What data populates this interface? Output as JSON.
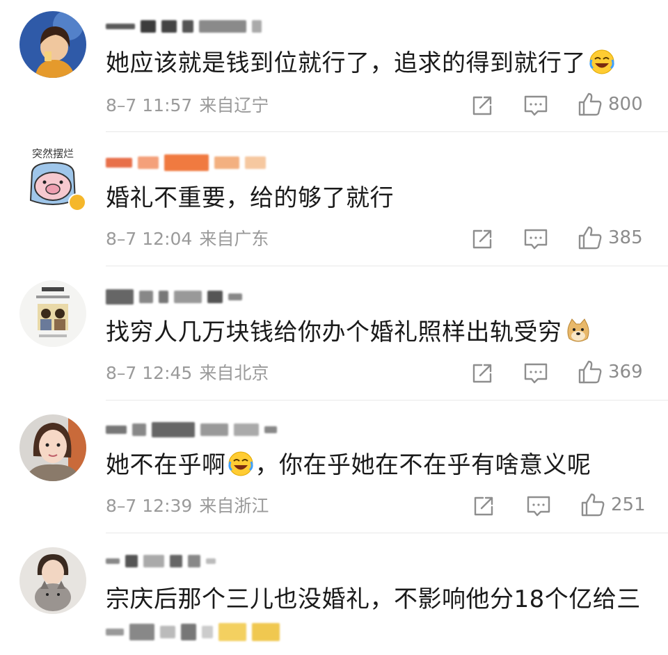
{
  "comments": [
    {
      "text": "她应该就是钱到位就行了，追求的得到就行了",
      "emoji": "laugh-cry-emoji",
      "time": "8–7 11:57",
      "location": "来自辽宁",
      "likes": "800"
    },
    {
      "text": "婚礼不重要，给的够了就行",
      "time": "8–7 12:04",
      "location": "来自广东",
      "likes": "385"
    },
    {
      "text": "找穷人几万块钱给你办个婚礼照样出轨受穷",
      "emoji": "doge-emoji",
      "time": "8–7 12:45",
      "location": "来自北京",
      "likes": "369"
    },
    {
      "text_before": "她不在乎啊",
      "text_after": "，你在乎她在不在乎有啥意义呢",
      "emoji": "laugh-cry-emoji",
      "time": "8–7 12:39",
      "location": "来自浙江",
      "likes": "251"
    },
    {
      "text": "宗庆后那个三儿也没婚礼，不影响他分18个亿给三"
    }
  ],
  "avatar_badges": {
    "comment2_avatar_text": "突然摆烂"
  },
  "colors": {
    "text": "#1a1a1a",
    "meta": "#9a9a9a",
    "icon": "#8e8e8e",
    "verified_badge": "#f5b72b"
  }
}
